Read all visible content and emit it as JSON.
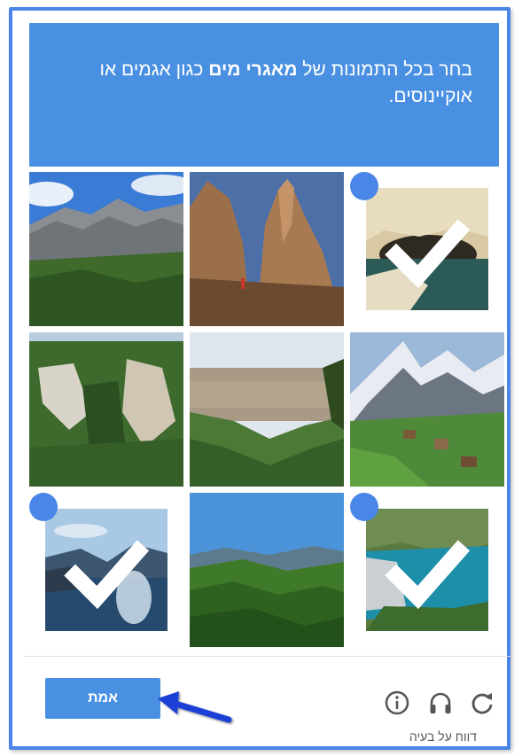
{
  "header": {
    "instruction_part1": "בחר בכל התמונות של ",
    "instruction_bold": "מאגרי מים",
    "instruction_part2": " כגון אגמים או אוקיינוסים."
  },
  "tiles": [
    {
      "scene": "mountain-ridge",
      "selected": false
    },
    {
      "scene": "rock-spires",
      "selected": false
    },
    {
      "scene": "sea-cave",
      "selected": true
    },
    {
      "scene": "gorge-cliffs",
      "selected": false
    },
    {
      "scene": "valley-town",
      "selected": false
    },
    {
      "scene": "alpine-village",
      "selected": false
    },
    {
      "scene": "lake-sunset",
      "selected": true
    },
    {
      "scene": "green-hills",
      "selected": false
    },
    {
      "scene": "turquoise-lake",
      "selected": true
    }
  ],
  "footer": {
    "verify_label": "אמת",
    "report_label": "דווח על בעיה",
    "icons": [
      "refresh-icon",
      "headphones-icon",
      "info-icon"
    ]
  },
  "colors": {
    "accent": "#4a90e2",
    "check": "#4a86e8",
    "arrow": "#1d3fd6"
  }
}
